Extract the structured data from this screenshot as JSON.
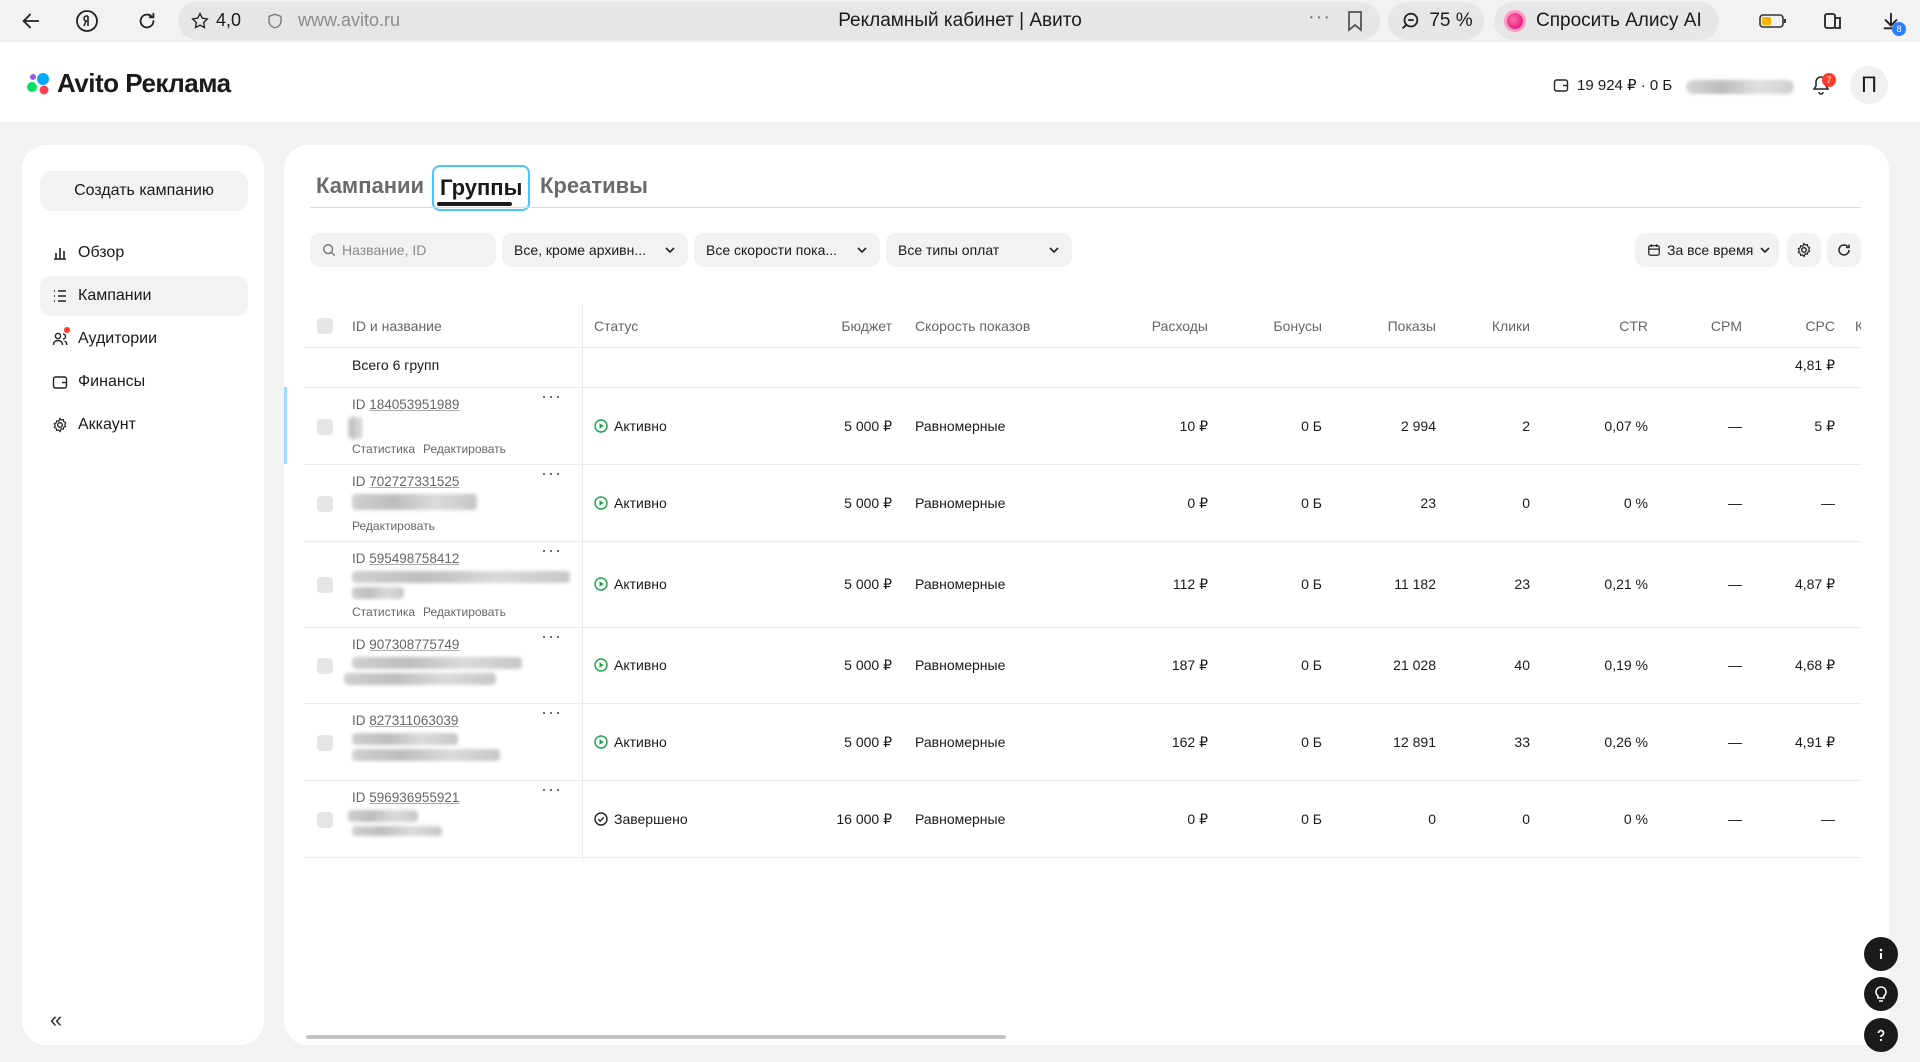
{
  "browser": {
    "rating": "4,0",
    "url": "www.avito.ru",
    "page_title": "Рекламный кабинет | Авито",
    "zoom": "75 %",
    "alisa": "Спросить Алису AI",
    "downloads_badge": "8"
  },
  "header": {
    "logo": "Avito Реклама",
    "balance": "19 924 ₽ · 0 Б",
    "notifications": "7",
    "avatar_letter": "П"
  },
  "sidebar": {
    "create_button": "Создать кампанию",
    "items": [
      {
        "label": "Обзор",
        "icon": "chart-icon"
      },
      {
        "label": "Кампании",
        "icon": "list-icon"
      },
      {
        "label": "Аудитории",
        "icon": "users-icon"
      },
      {
        "label": "Финансы",
        "icon": "wallet-icon"
      },
      {
        "label": "Аккаунт",
        "icon": "gear-icon"
      }
    ],
    "active_item": "Кампании"
  },
  "tabs": {
    "items": [
      "Кампании",
      "Группы",
      "Креативы"
    ],
    "active": "Группы"
  },
  "filters": {
    "search_placeholder": "Название, ID",
    "status_filter": "Все, кроме архивн...",
    "speed_filter": "Все скорости пока...",
    "payment_filter": "Все типы оплат",
    "period": "За все время"
  },
  "table": {
    "columns": [
      "ID и название",
      "Статус",
      "Бюджет",
      "Скорость показов",
      "Расходы",
      "Бонусы",
      "Показы",
      "Клики",
      "CTR",
      "CPM",
      "CPC",
      "К"
    ],
    "total": {
      "label": "Всего 6 групп",
      "cpc": "4,81 ₽"
    },
    "id_prefix": "ID",
    "link_stats": "Статистика",
    "link_edit": "Редактировать",
    "rows": [
      {
        "id": "184053951989",
        "status": "Активно",
        "budget": "5 000 ₽",
        "speed": "Равномерные",
        "spend": "10 ₽",
        "bonus": "0 Б",
        "shows": "2 994",
        "clicks": "2",
        "ctr": "0,07 %",
        "cpm": "—",
        "cpc": "5 ₽"
      },
      {
        "id": "702727331525",
        "status": "Активно",
        "budget": "5 000 ₽",
        "speed": "Равномерные",
        "spend": "0 ₽",
        "bonus": "0 Б",
        "shows": "23",
        "clicks": "0",
        "ctr": "0 %",
        "cpm": "—",
        "cpc": "—"
      },
      {
        "id": "595498758412",
        "status": "Активно",
        "budget": "5 000 ₽",
        "speed": "Равномерные",
        "spend": "112 ₽",
        "bonus": "0 Б",
        "shows": "11 182",
        "clicks": "23",
        "ctr": "0,21 %",
        "cpm": "—",
        "cpc": "4,87 ₽"
      },
      {
        "id": "907308775749",
        "status": "Активно",
        "budget": "5 000 ₽",
        "speed": "Равномерные",
        "spend": "187 ₽",
        "bonus": "0 Б",
        "shows": "21 028",
        "clicks": "40",
        "ctr": "0,19 %",
        "cpm": "—",
        "cpc": "4,68 ₽"
      },
      {
        "id": "827311063039",
        "status": "Активно",
        "budget": "5 000 ₽",
        "speed": "Равномерные",
        "spend": "162 ₽",
        "bonus": "0 Б",
        "shows": "12 891",
        "clicks": "33",
        "ctr": "0,26 %",
        "cpm": "—",
        "cpc": "4,91 ₽"
      },
      {
        "id": "596936955921",
        "status": "Завершено",
        "budget": "16 000 ₽",
        "speed": "Равномерные",
        "spend": "0 ₽",
        "bonus": "0 Б",
        "shows": "0",
        "clicks": "0",
        "ctr": "0 %",
        "cpm": "—",
        "cpc": "—"
      }
    ]
  },
  "colors": {
    "accent": "#4dc3ff",
    "active_status": "#1aa34a",
    "badge": "#ff3b30"
  }
}
